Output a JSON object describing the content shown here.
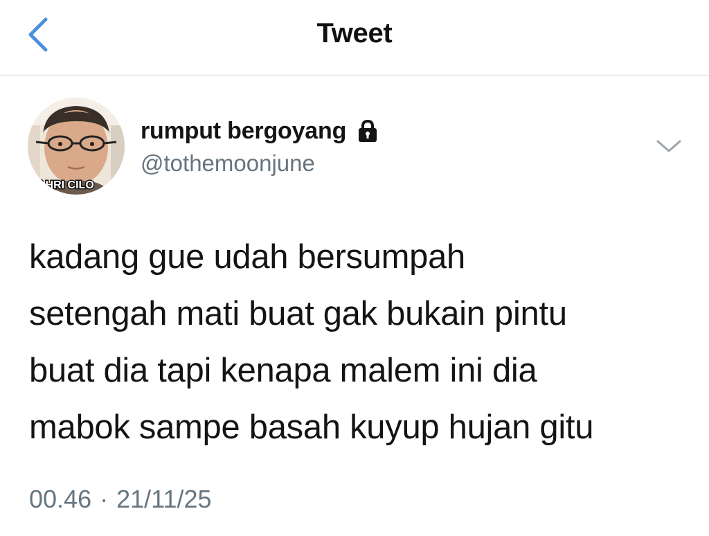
{
  "colors": {
    "accent": "#4a90e2",
    "text": "#141414",
    "muted": "#66757f",
    "divider": "#d4d6d9"
  },
  "navbar": {
    "back_icon": "chevron-left-icon",
    "title": "Tweet"
  },
  "author": {
    "display_name": "rumput bergoyang",
    "protected_icon": "lock-icon",
    "handle": "@tothemoonjune",
    "avatar_caption": "AHRI CILO",
    "menu_icon": "chevron-down-icon"
  },
  "tweet": {
    "lines": [
      "kadang gue udah bersumpah",
      "setengah mati buat gak bukain pintu",
      "buat dia tapi kenapa malem ini dia",
      "mabok sampe basah kuyup hujan gitu"
    ],
    "time": "00.46",
    "separator": "·",
    "date": "21/11/25"
  }
}
